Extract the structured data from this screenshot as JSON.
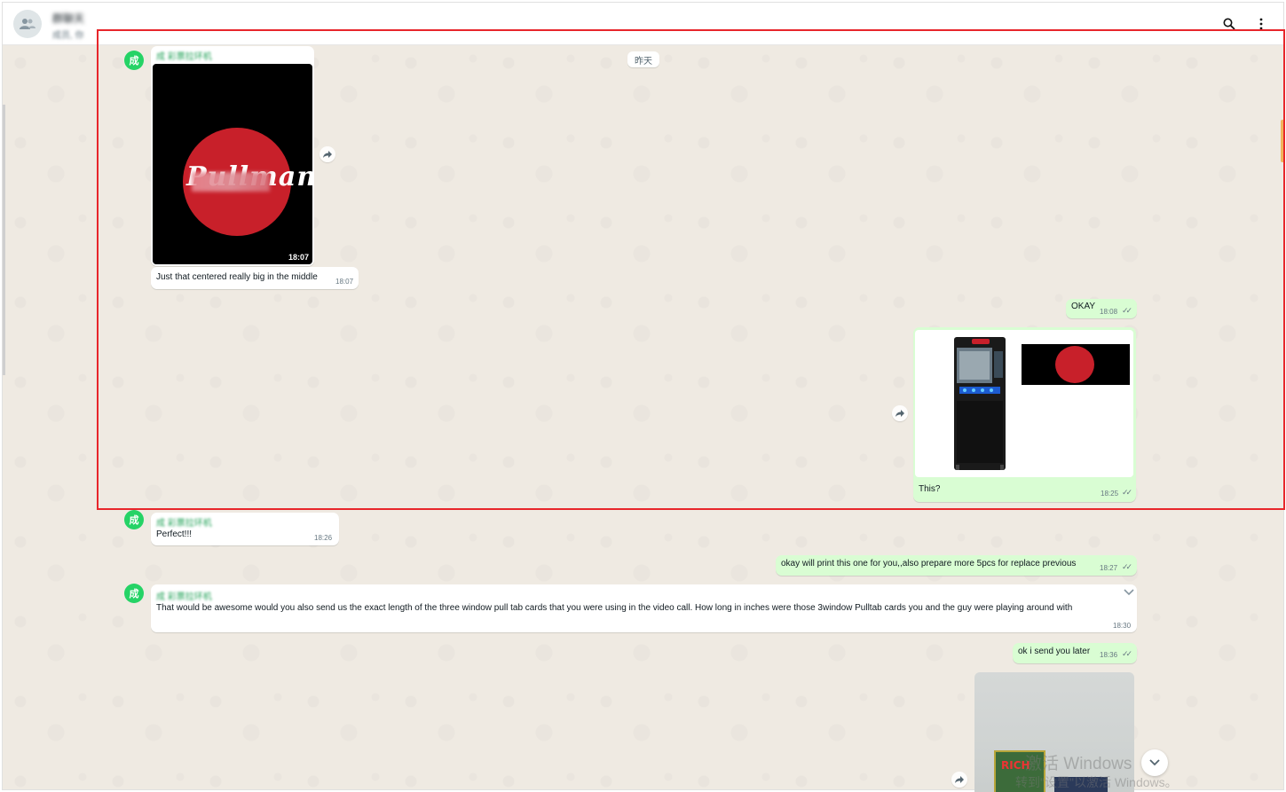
{
  "header": {
    "chat_name": "群聊天",
    "chat_subtitle": "成员, 你",
    "search_icon": "search-icon",
    "menu_icon": "kebab-menu-icon"
  },
  "date_chip": "昨天",
  "group_avatar_char": "成",
  "messages": {
    "m1": {
      "sender": "成 彩票拉环机",
      "video_time": "18:07",
      "video_logo": "Pullman's",
      "caption": "Just that centered really big in the middle",
      "time": "18:07"
    },
    "m2": {
      "text": "OKAY",
      "time": "18:08"
    },
    "m3": {
      "caption": "This?",
      "time": "18:25"
    },
    "m4": {
      "sender": "成 彩票拉环机",
      "text": "Perfect!!!",
      "time": "18:26"
    },
    "m5": {
      "text": "okay will print this one for you,,also prepare more 5pcs for replace previous",
      "time": "18:27"
    },
    "m6": {
      "sender": "成 彩票拉环机",
      "text": "That would be awesome would you also send us the exact length of the three window pull tab cards that you were using in the video call. How long in inches were those 3window  Pulltab cards you and the guy were playing around with",
      "time": "18:30"
    },
    "m7": {
      "text": "ok i send you later",
      "time": "18:36"
    },
    "m8": {
      "photo_label": "RICH"
    }
  },
  "watermark": {
    "line1": "激活 Windows",
    "line2": "转到\"设置\"以激活 Windows。"
  },
  "colors": {
    "incoming": "#ffffff",
    "outgoing": "#d9fdd3",
    "wallpaper": "#efeae2",
    "accent_green": "#25d366",
    "selection": "#e8262b"
  }
}
